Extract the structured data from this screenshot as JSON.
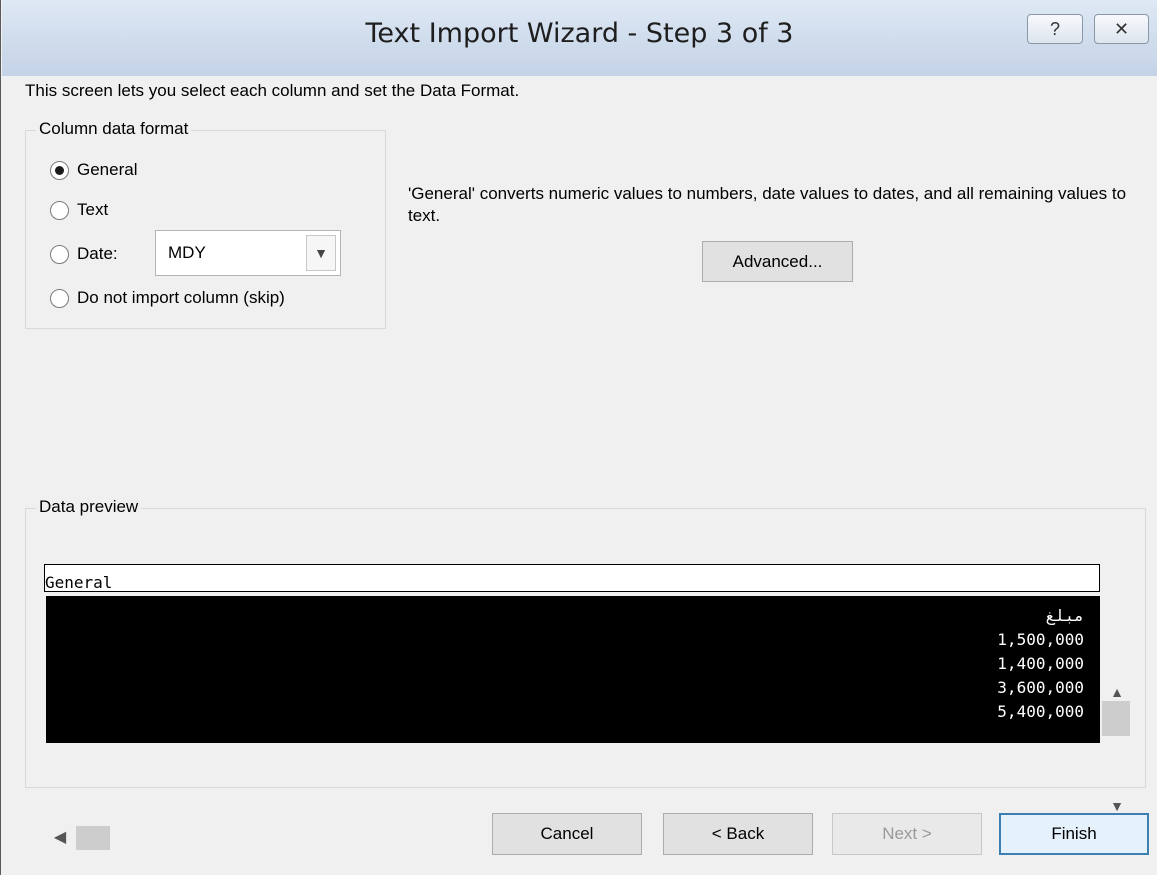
{
  "window": {
    "title": "Text Import Wizard - Step 3 of 3",
    "help_glyph": "?",
    "close_glyph": "✕"
  },
  "intro_text": "This screen lets you select each column and set the Data Format.",
  "column_format": {
    "legend": "Column data format",
    "options": [
      {
        "label": "General",
        "checked": true
      },
      {
        "label": "Text",
        "checked": false
      },
      {
        "label": "Date:",
        "checked": false
      },
      {
        "label": "Do not import column (skip)",
        "checked": false
      }
    ],
    "date_format_value": "MDY"
  },
  "description": "'General' converts numeric values to numbers, date values to dates, and all remaining values to text.",
  "advanced_button": "Advanced...",
  "data_preview": {
    "legend": "Data preview",
    "column_header": "General",
    "rows": [
      "مبلغ",
      "1,500,000",
      "1,400,000",
      "3,600,000",
      "5,400,000"
    ]
  },
  "buttons": {
    "cancel": "Cancel",
    "back": "< Back",
    "next": "Next >",
    "finish": "Finish"
  }
}
